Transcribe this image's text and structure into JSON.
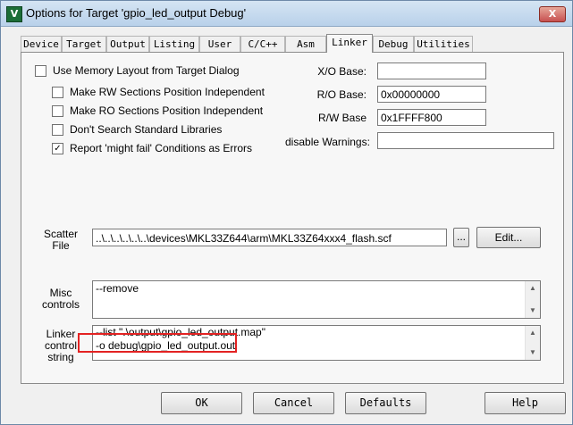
{
  "window": {
    "title": "Options for Target 'gpio_led_output Debug'",
    "icon_letter": "V",
    "close_label": "X"
  },
  "tabs": [
    "Device",
    "Target",
    "Output",
    "Listing",
    "User",
    "C/C++",
    "Asm",
    "Linker",
    "Debug",
    "Utilities"
  ],
  "active_tab": "Linker",
  "linker": {
    "use_memory_layout": {
      "label": "Use Memory Layout from Target Dialog",
      "checked": false
    },
    "rw_independent": {
      "label": "Make RW Sections Position Independent",
      "checked": false
    },
    "ro_independent": {
      "label": "Make RO Sections Position Independent",
      "checked": false
    },
    "dont_search_std": {
      "label": "Don't Search Standard Libraries",
      "checked": false
    },
    "report_might_fail": {
      "label": "Report 'might fail' Conditions as Errors",
      "checked": true
    },
    "xo_base": {
      "label": "X/O Base:",
      "value": ""
    },
    "ro_base": {
      "label": "R/O Base:",
      "value": "0x00000000"
    },
    "rw_base": {
      "label": "R/W Base",
      "value": "0x1FFFF800"
    },
    "disable_warnings": {
      "label": "disable Warnings:",
      "value": ""
    },
    "scatter_file": {
      "label_line1": "Scatter",
      "label_line2": "File",
      "value": "..\\..\\..\\..\\..\\..\\devices\\MKL33Z644\\arm\\MKL33Z64xxx4_flash.scf",
      "browse_label": "...",
      "edit_label": "Edit..."
    },
    "misc_controls": {
      "label_line1": "Misc",
      "label_line2": "controls",
      "value": "--remove"
    },
    "linker_control": {
      "label_line1": "Linker",
      "label_line2": "control",
      "label_line3": "string",
      "line1": "--list \".\\output\\gpio_led_output.map\"",
      "line2": "-o debug\\gpio_led_output.out"
    }
  },
  "buttons": {
    "ok": "OK",
    "cancel": "Cancel",
    "defaults": "Defaults",
    "help": "Help"
  },
  "colors": {
    "highlight_border": "#e32222",
    "titlebar": "#c3d8ee"
  },
  "icons": {
    "scroll_up": "▲",
    "scroll_down": "▼"
  }
}
